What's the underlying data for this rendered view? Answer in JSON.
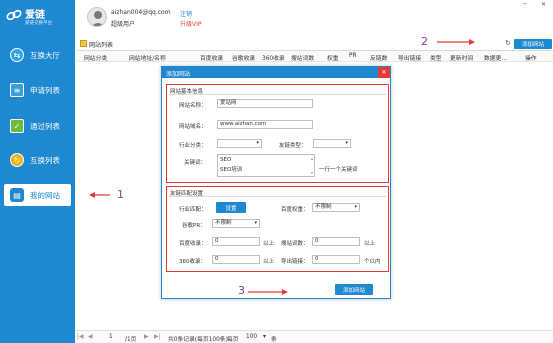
{
  "logo": {
    "name": "爱链",
    "tagline": "爱链交换平台"
  },
  "user": {
    "email": "aizhan004@qq.com",
    "role": "超级用户",
    "logout": "注销",
    "upgrade": "升级VIP"
  },
  "window_controls": {
    "minimize": "─",
    "close": "✕"
  },
  "sidebar": {
    "items": [
      {
        "label": "互换大厅",
        "icon": "transfer-icon"
      },
      {
        "label": "申请列表",
        "icon": "list-icon"
      },
      {
        "label": "通过列表",
        "icon": "check-icon"
      },
      {
        "label": "互换列表",
        "icon": "exchange-icon"
      },
      {
        "label": "我的网站",
        "icon": "layers-icon",
        "active": true
      }
    ]
  },
  "tab": {
    "label": "网站列表"
  },
  "toolbar": {
    "add_site": "添加网站",
    "refresh_icon": "refresh-icon"
  },
  "table": {
    "columns": [
      "网站分类",
      "网站地址/名称",
      "百度收录",
      "谷歌收录",
      "360收录",
      "搜站词数",
      "权重",
      "PR",
      "反链数",
      "导出链接",
      "类型",
      "更新时间",
      "数据更...",
      "操作"
    ]
  },
  "pager": {
    "first": "|◀",
    "prev": "◀",
    "page": "1",
    "total_pages": "/1页",
    "next": "▶",
    "last": "▶|",
    "summary": "共0条记录(每页100条)",
    "per_page_label": "每页",
    "per_page": "100",
    "unit": "条"
  },
  "dialog": {
    "title": "添加网站",
    "close": "✕",
    "basic": {
      "title": "网站基本信息",
      "name_label": "网站名称：",
      "name_value": "爱站网",
      "domain_label": "网站域名：",
      "domain_value": "www.aizhan.com",
      "category_label": "行业分类：",
      "category_value": "",
      "linktype_label": "友链类型：",
      "linktype_value": "",
      "keywords_label": "关键词：",
      "keywords": [
        "SEO",
        "SEO培训"
      ],
      "hint": "一行一个关键词"
    },
    "match": {
      "title": "友链匹配设置",
      "industry_label": "行业匹配：",
      "industry_button": "设置",
      "baidu_weight_label": "百度权重：",
      "baidu_weight_value": "不限制",
      "google_pr_label": "谷歌PR：",
      "google_pr_value": "不限制",
      "baidu_index_label": "百度收录：",
      "baidu_index_value": "0",
      "baidu_index_unit": "以上",
      "keyword_count_label": "搜站词数：",
      "keyword_count_value": "0",
      "keyword_count_unit": "以上",
      "index360_label": "360收录：",
      "index360_value": "0",
      "index360_unit": "以上",
      "outlinks_label": "导出链接：",
      "outlinks_value": "0",
      "outlinks_unit": "个以内"
    },
    "submit": "添加网站"
  },
  "annotations": {
    "a1": "1",
    "a2": "2",
    "a3": "3"
  },
  "colors": {
    "sidebar": "#1e88d0",
    "dialog_border": "#1e88d0",
    "highlight_red": "#e53935",
    "annotation": "#8e3a8c"
  }
}
